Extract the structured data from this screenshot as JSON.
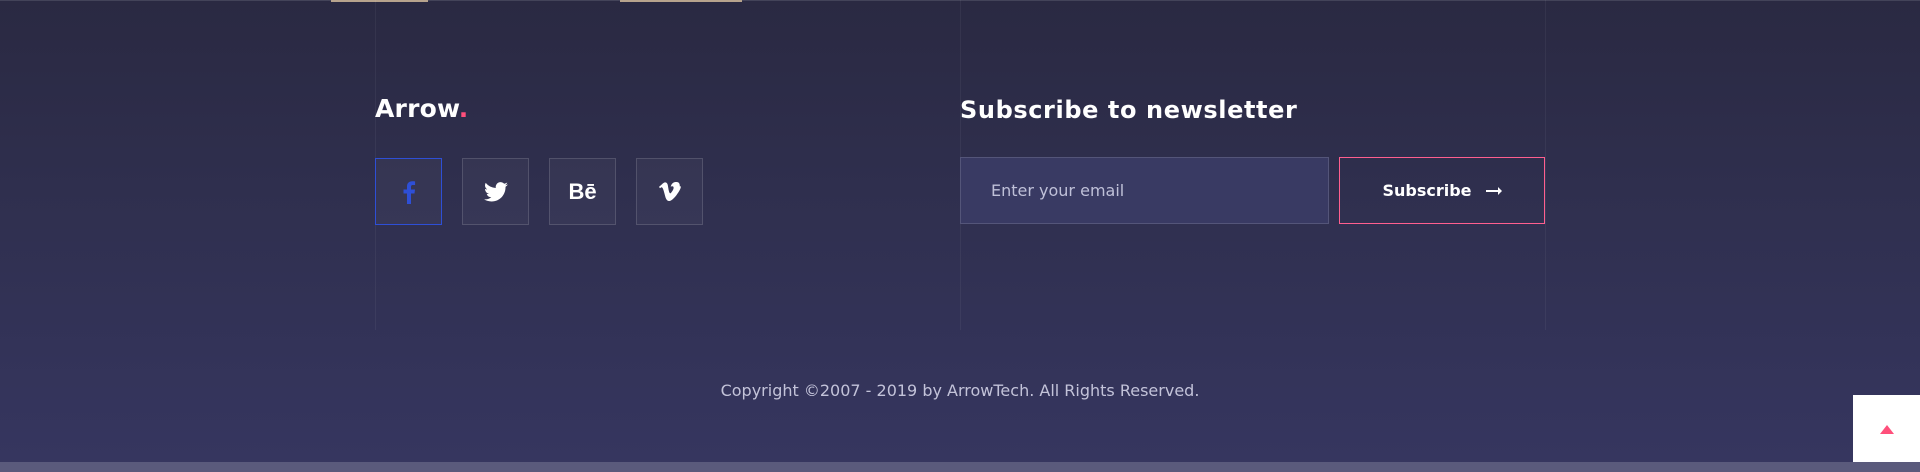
{
  "brand": {
    "name": "Arrow",
    "dot": "."
  },
  "social": [
    {
      "icon": "facebook-icon"
    },
    {
      "icon": "twitter-icon"
    },
    {
      "icon": "behance-icon",
      "glyph": "Bē"
    },
    {
      "icon": "vimeo-icon"
    }
  ],
  "newsletter": {
    "title": "Subscribe to newsletter",
    "email_placeholder": "Enter your email",
    "email_value": "",
    "subscribe_label": "Subscribe"
  },
  "footer": {
    "copyright": "Copyright ©2007 - 2019 by ArrowTech. All Rights Reserved."
  },
  "colors": {
    "accent": "#ff4f7b",
    "facebook": "#2e4fd6",
    "background": "#2f2f4e"
  }
}
